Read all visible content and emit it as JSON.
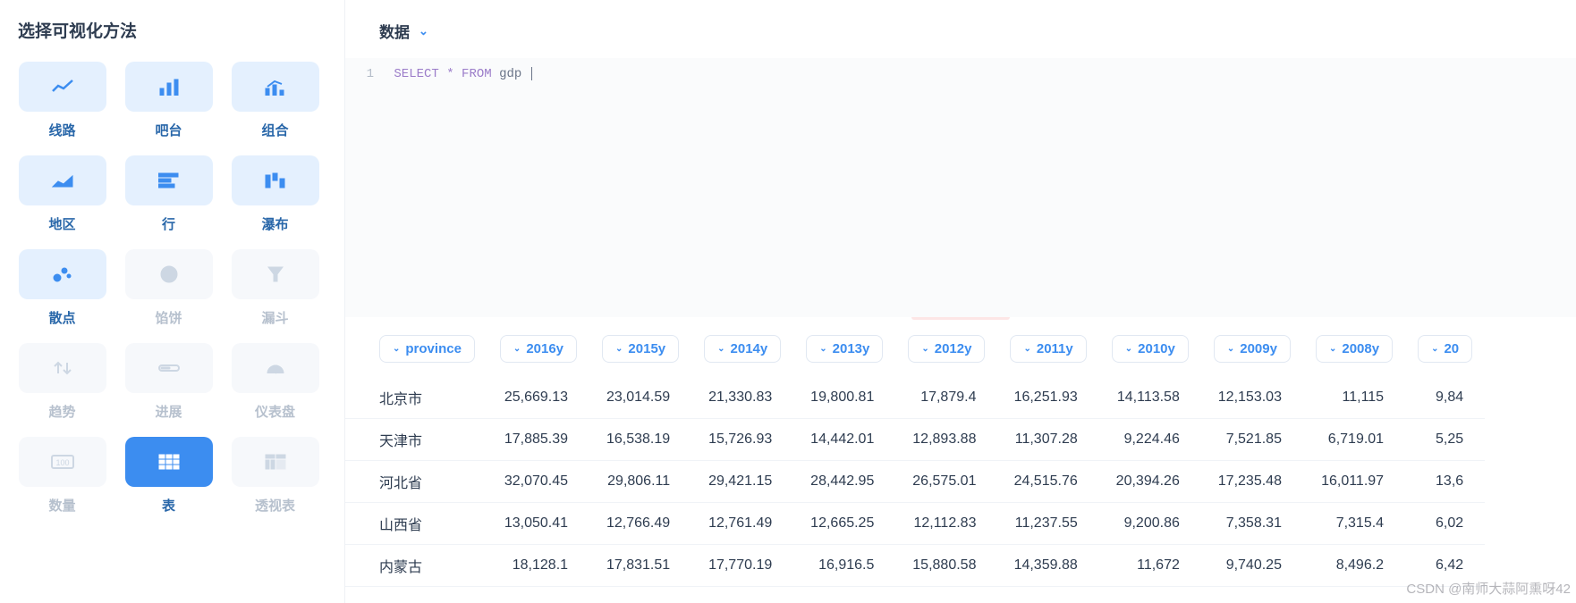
{
  "sidebar": {
    "title": "选择可视化方法",
    "items": [
      {
        "id": "line",
        "label": "线路",
        "state": "enabled",
        "icon": "line"
      },
      {
        "id": "bar",
        "label": "吧台",
        "state": "enabled",
        "icon": "bar"
      },
      {
        "id": "combo",
        "label": "组合",
        "state": "enabled",
        "icon": "combo"
      },
      {
        "id": "area",
        "label": "地区",
        "state": "enabled",
        "icon": "area"
      },
      {
        "id": "row",
        "label": "行",
        "state": "enabled",
        "icon": "row"
      },
      {
        "id": "waterfall",
        "label": "瀑布",
        "state": "enabled",
        "icon": "waterfall"
      },
      {
        "id": "scatter",
        "label": "散点",
        "state": "enabled",
        "icon": "scatter"
      },
      {
        "id": "pie",
        "label": "馅饼",
        "state": "disabled",
        "icon": "pie"
      },
      {
        "id": "funnel",
        "label": "漏斗",
        "state": "disabled",
        "icon": "funnel"
      },
      {
        "id": "trend",
        "label": "趋势",
        "state": "disabled",
        "icon": "trend"
      },
      {
        "id": "progress",
        "label": "进展",
        "state": "disabled",
        "icon": "progress"
      },
      {
        "id": "gauge",
        "label": "仪表盘",
        "state": "disabled",
        "icon": "gauge"
      },
      {
        "id": "number",
        "label": "数量",
        "state": "disabled",
        "icon": "number"
      },
      {
        "id": "table",
        "label": "表",
        "state": "selected",
        "icon": "table"
      },
      {
        "id": "pivot",
        "label": "透视表",
        "state": "disabled",
        "icon": "pivot"
      }
    ]
  },
  "main": {
    "header": "数据",
    "lineNumber": "1",
    "sqlKeywords": [
      "SELECT",
      "*",
      "FROM"
    ],
    "sqlTable": "gdp"
  },
  "watermark": "CSDN @南师大蒜阿熏呀42",
  "table": {
    "columns": [
      "province",
      "2016y",
      "2015y",
      "2014y",
      "2013y",
      "2012y",
      "2011y",
      "2010y",
      "2009y",
      "2008y",
      "20"
    ],
    "rows": [
      [
        "北京市",
        "25,669.13",
        "23,014.59",
        "21,330.83",
        "19,800.81",
        "17,879.4",
        "16,251.93",
        "14,113.58",
        "12,153.03",
        "11,115",
        "9,84"
      ],
      [
        "天津市",
        "17,885.39",
        "16,538.19",
        "15,726.93",
        "14,442.01",
        "12,893.88",
        "11,307.28",
        "9,224.46",
        "7,521.85",
        "6,719.01",
        "5,25"
      ],
      [
        "河北省",
        "32,070.45",
        "29,806.11",
        "29,421.15",
        "28,442.95",
        "26,575.01",
        "24,515.76",
        "20,394.26",
        "17,235.48",
        "16,011.97",
        "13,6"
      ],
      [
        "山西省",
        "13,050.41",
        "12,766.49",
        "12,761.49",
        "12,665.25",
        "12,112.83",
        "11,237.55",
        "9,200.86",
        "7,358.31",
        "7,315.4",
        "6,02"
      ],
      [
        "内蒙古",
        "18,128.1",
        "17,831.51",
        "17,770.19",
        "16,916.5",
        "15,880.58",
        "14,359.88",
        "11,672",
        "9,740.25",
        "8,496.2",
        "6,42"
      ]
    ]
  }
}
